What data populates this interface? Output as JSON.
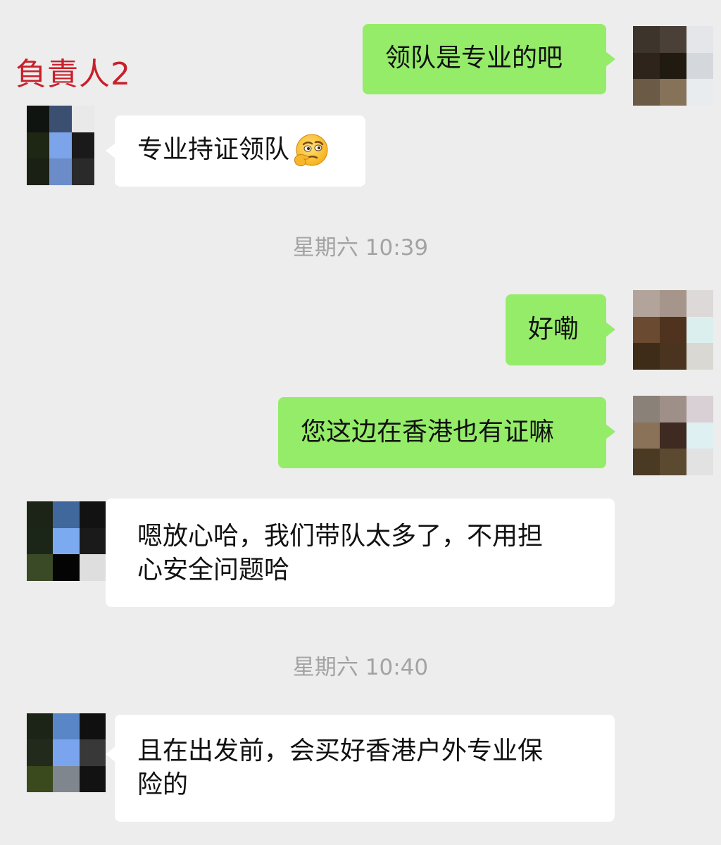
{
  "annotation_label": "負責人2",
  "messages": [
    {
      "side": "out",
      "text": "领队是专业的吧"
    },
    {
      "side": "in",
      "text": "专业持证领队",
      "emoji": "thinking-face-emoji"
    },
    {
      "timestamp": "星期六 10:39"
    },
    {
      "side": "out",
      "text": "好嘞"
    },
    {
      "side": "out",
      "text": "您这边在香港也有证嘛"
    },
    {
      "side": "in",
      "lines": [
        "嗯放心哈，我们带队太多了，不用担",
        "心安全问题哈"
      ]
    },
    {
      "timestamp": "星期六 10:40"
    },
    {
      "side": "in",
      "lines": [
        "且在出发前，会买好香港户外专业保",
        "险的"
      ]
    }
  ],
  "colors": {
    "background": "#ededed",
    "incoming_bubble": "#ffffff",
    "outgoing_bubble": "#95ec69",
    "annotation": "#c8202b",
    "timestamp_text": "#a3a3a3"
  },
  "avatars": {
    "self": [
      "#3d342c",
      "#4a4037",
      "#e4e6ea",
      "#2e241c",
      "#211a10",
      "#d4d8dc",
      "#6a5a46",
      "#857258",
      "#e9ecee"
    ],
    "self_2": [
      "#b2a49a",
      "#a6958a",
      "#dcd9d8",
      "#6a4a30",
      "#4f331e",
      "#dcefef",
      "#3e2c18",
      "#4a3420",
      "#d9d8d2"
    ],
    "self_3": [
      "#8a8178",
      "#9e9088",
      "#d8d0d4",
      "#8a7258",
      "#3e2a20",
      "#dff0f2",
      "#4a3a24",
      "#5c4a30",
      "#e2e2e2"
    ],
    "agent_1": [
      "#101410",
      "#3b5070",
      "#e9e9e9",
      "#1e2614",
      "#7ba4ea",
      "#1a1a1a",
      "#1a2014",
      "#6b8cc8",
      "#2a2a2a"
    ],
    "agent_2": [
      "#1c2418",
      "#40689c",
      "#121212",
      "#1c2618",
      "#7caaf0",
      "#1a1a1a",
      "#3a4a26",
      "#040404",
      "#dedede"
    ],
    "agent_3": [
      "#1c2418",
      "#5886c6",
      "#101010",
      "#222a1c",
      "#7aa4ee",
      "#383838",
      "#3a4a1c",
      "#80868e",
      "#121212"
    ]
  }
}
